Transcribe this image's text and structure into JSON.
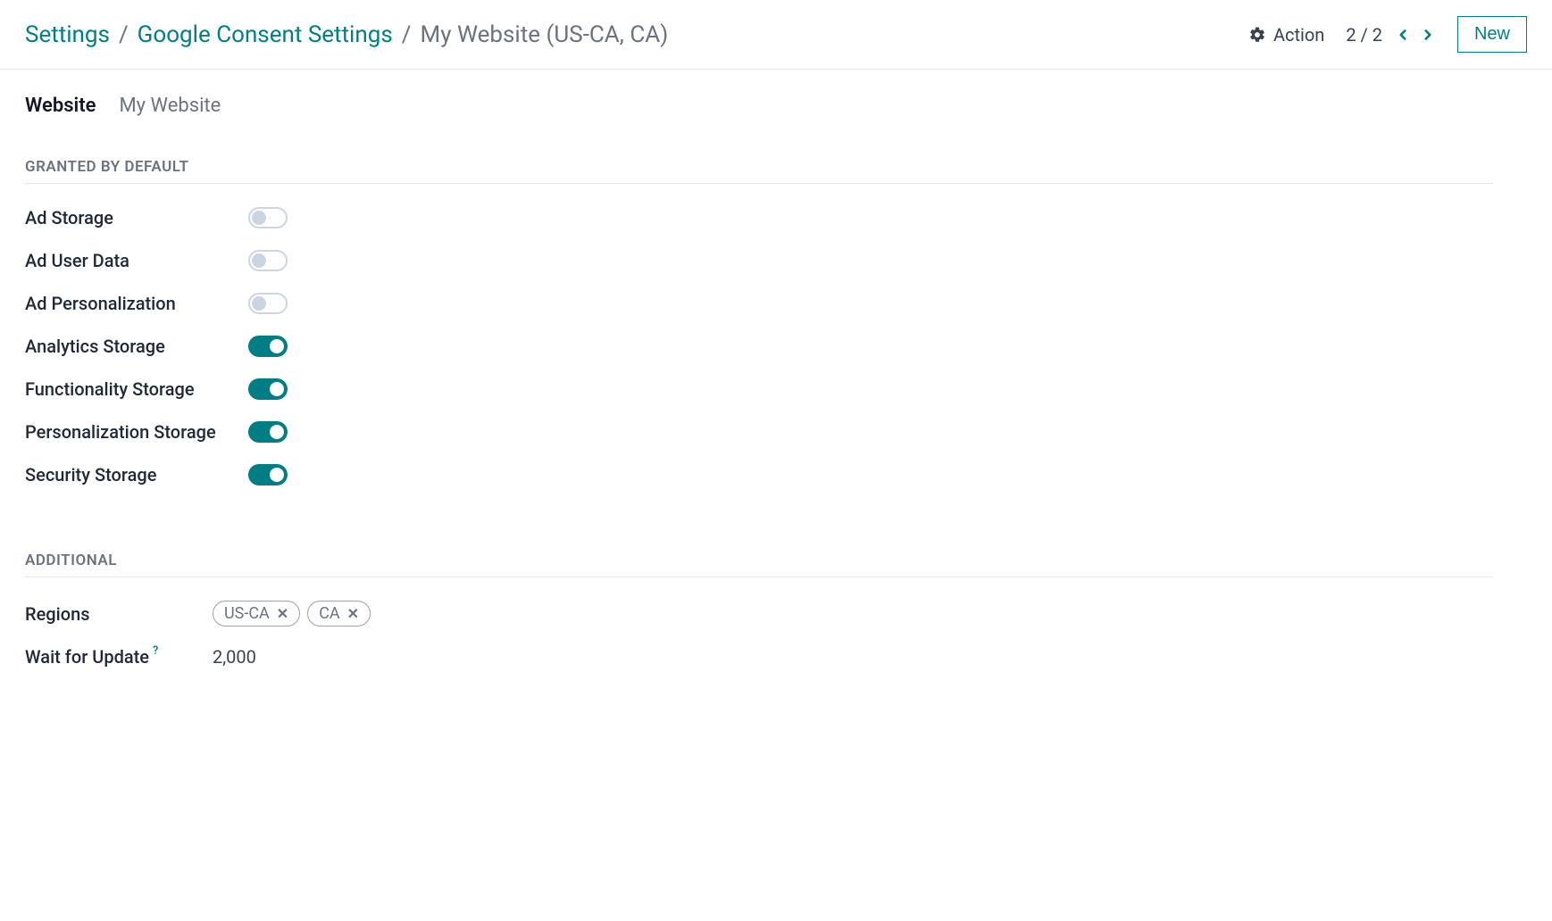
{
  "breadcrumb": {
    "root": "Settings",
    "parent": "Google Consent Settings",
    "current": "My Website (US-CA, CA)"
  },
  "header": {
    "action_label": "Action",
    "pager": "2 / 2",
    "new_label": "New"
  },
  "website": {
    "label": "Website",
    "value": "My Website"
  },
  "sections": {
    "granted": "GRANTED BY DEFAULT",
    "additional": "ADDITIONAL"
  },
  "toggles": [
    {
      "label": "Ad Storage",
      "on": false
    },
    {
      "label": "Ad User Data",
      "on": false
    },
    {
      "label": "Ad Personalization",
      "on": false
    },
    {
      "label": "Analytics Storage",
      "on": true
    },
    {
      "label": "Functionality Storage",
      "on": true
    },
    {
      "label": "Personalization Storage",
      "on": true
    },
    {
      "label": "Security Storage",
      "on": true
    }
  ],
  "regions": {
    "label": "Regions",
    "tags": [
      "US-CA",
      "CA"
    ]
  },
  "wait": {
    "label": "Wait for Update",
    "value": "2,000"
  }
}
